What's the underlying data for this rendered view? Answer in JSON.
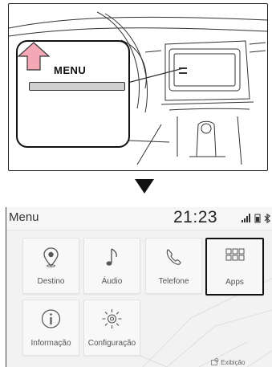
{
  "illustration": {
    "menu_label": "MENU"
  },
  "screen": {
    "title": "Menu",
    "clock": "21:23",
    "status_icons": [
      "signal-icon",
      "battery-icon",
      "bluetooth-icon"
    ],
    "tiles": [
      {
        "label": "Destino",
        "icon": "location-pin-icon"
      },
      {
        "label": "Áudio",
        "icon": "music-note-icon"
      },
      {
        "label": "Telefone",
        "icon": "phone-icon"
      },
      {
        "label": "Apps",
        "icon": "apps-grid-icon",
        "selected": true
      },
      {
        "label": "Informação",
        "icon": "info-icon"
      },
      {
        "label": "Configuração",
        "icon": "gear-icon"
      }
    ],
    "footer_label": "Exibição"
  }
}
